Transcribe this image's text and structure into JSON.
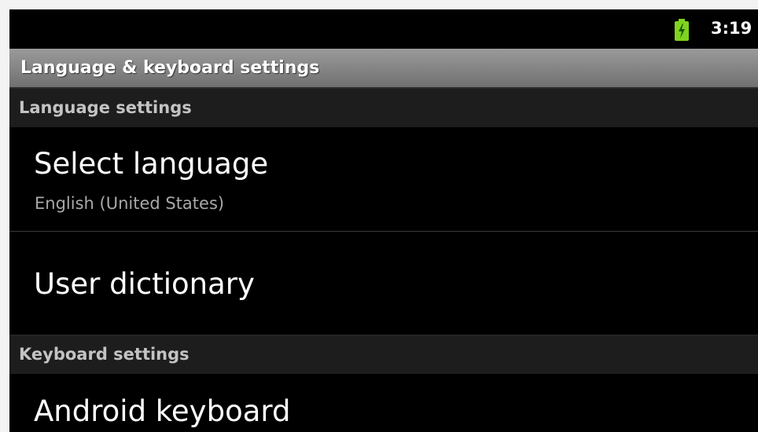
{
  "status_bar": {
    "time": "3:19",
    "battery_icon": "battery-charging-icon",
    "battery_color": "#7ed321"
  },
  "title_bar": {
    "title": "Language & keyboard settings"
  },
  "sections": [
    {
      "header": "Language settings",
      "items": [
        {
          "title": "Select language",
          "summary": "English (United States)"
        },
        {
          "title": "User dictionary"
        }
      ]
    },
    {
      "header": "Keyboard settings",
      "items": [
        {
          "title": "Android keyboard"
        }
      ]
    }
  ]
}
